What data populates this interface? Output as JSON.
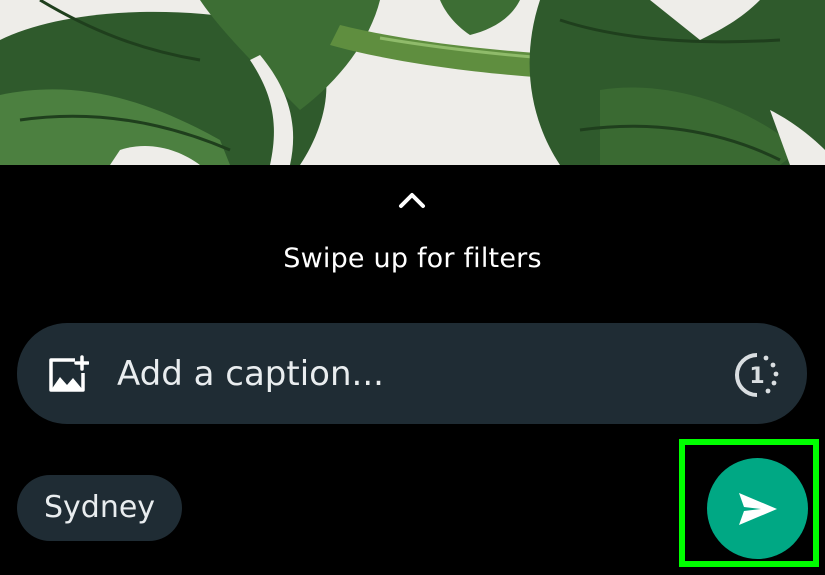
{
  "colors": {
    "background": "#000000",
    "surface": "#1f2c34",
    "accent": "#00a884",
    "highlight": "#00ff00",
    "text": "#ffffff"
  },
  "photo": {
    "icon": "monstera-leaf-photo"
  },
  "filters": {
    "chevron_icon": "chevron-up-icon",
    "hint": "Swipe up for filters"
  },
  "caption": {
    "add_media_icon": "add-image-icon",
    "placeholder": "Add a caption...",
    "view_once_icon": "view-once-icon",
    "view_once_value": "1"
  },
  "location": {
    "label": "Sydney"
  },
  "send": {
    "icon": "send-icon"
  }
}
